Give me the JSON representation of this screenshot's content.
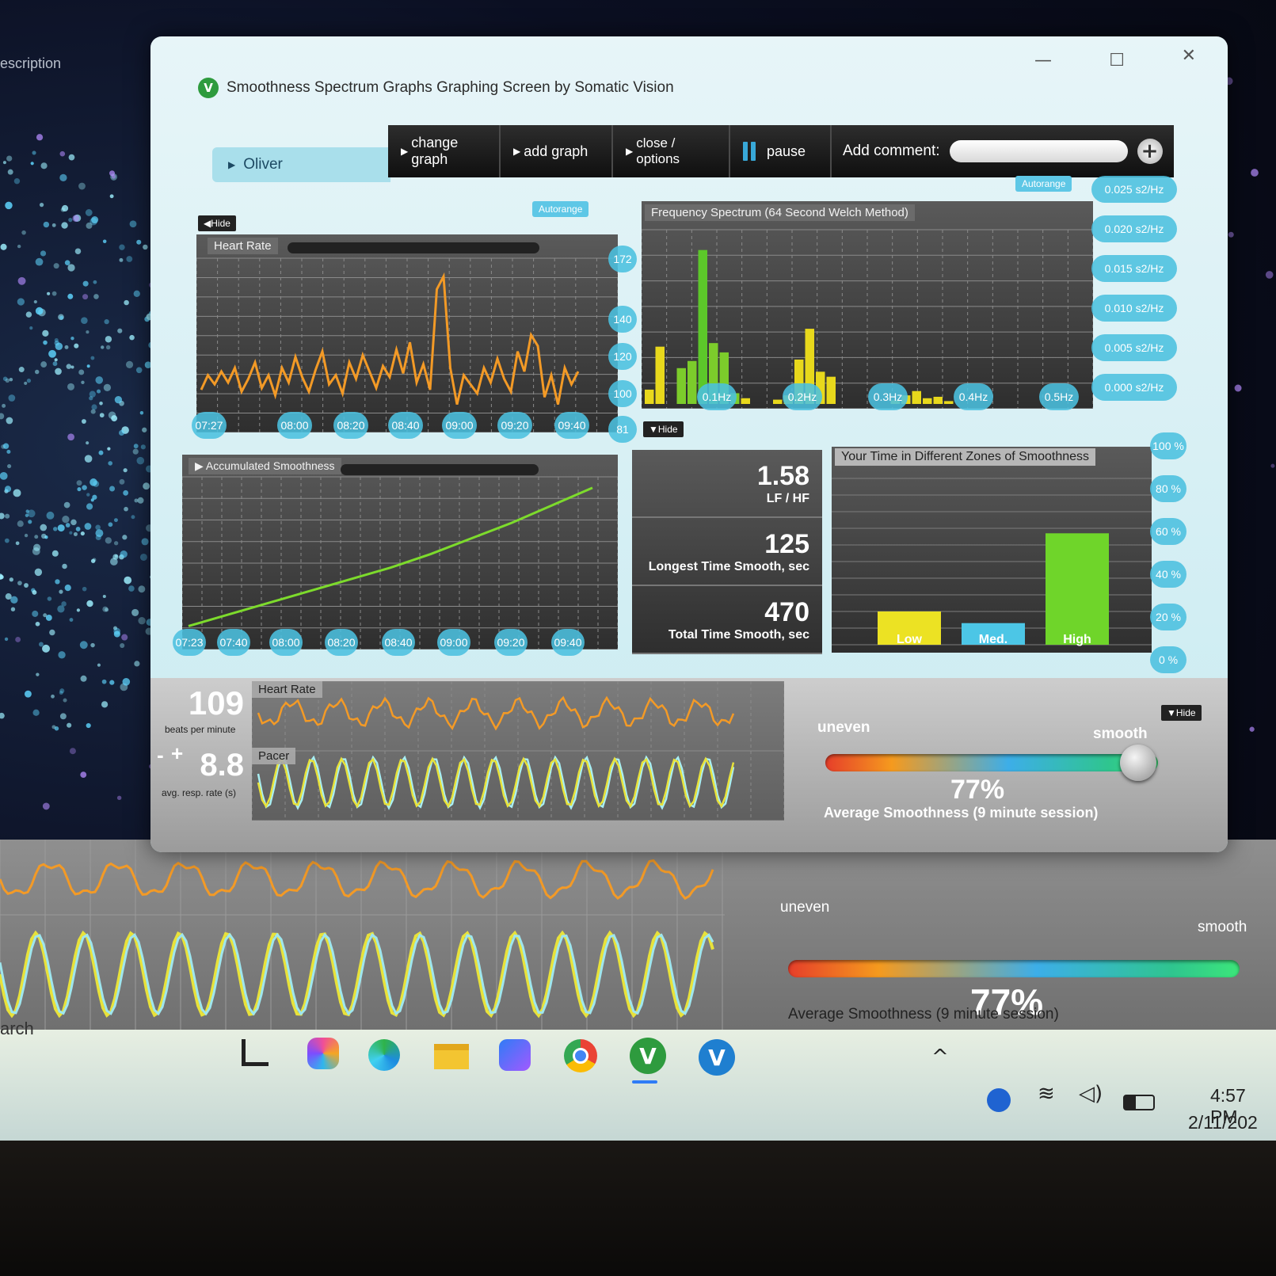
{
  "background": {
    "corner_text": "escription",
    "search_text": "arch"
  },
  "window": {
    "title": "Smoothness Spectrum Graphs Graphing Screen by Somatic Vision",
    "controls": {
      "minimize": "—",
      "maximize": "☐",
      "close": "✕"
    },
    "logo_glyph": "V"
  },
  "user": {
    "name": "Oliver"
  },
  "toolbar": {
    "change_graph": "change graph",
    "add_graph": "add graph",
    "close_options": "close / options",
    "pause": "pause",
    "add_comment_label": "Add comment:",
    "add_comment_value": "",
    "add_comment_plus": "+"
  },
  "heart_rate_panel": {
    "hide_label": "Hide",
    "autorange_label": "Autorange",
    "title": "Heart Rate",
    "y_ticks": [
      "172",
      "140",
      "120",
      "100",
      "81"
    ],
    "x_ticks": [
      "07:27",
      "08:00",
      "08:20",
      "08:40",
      "09:00",
      "09:20",
      "09:40"
    ],
    "series_color": "#f39a26",
    "values": [
      100,
      108,
      103,
      110,
      104,
      112,
      99,
      106,
      115,
      101,
      108,
      97,
      112,
      104,
      118,
      107,
      99,
      111,
      121,
      103,
      108,
      98,
      115,
      106,
      119,
      110,
      101,
      113,
      107,
      122,
      109,
      126,
      104,
      114,
      100,
      155,
      162,
      112,
      92,
      108,
      103,
      98,
      112,
      104,
      117,
      106,
      99,
      121,
      110,
      130,
      124,
      96,
      108,
      92,
      112,
      103,
      110
    ]
  },
  "spectrum_panel": {
    "autorange_label": "Autorange",
    "title": "Frequency Spectrum (64 Second Welch Method)",
    "hide_label": "Hide",
    "y_ticks": [
      "0.025 s2/Hz",
      "0.020 s2/Hz",
      "0.015 s2/Hz",
      "0.010 s2/Hz",
      "0.005 s2/Hz",
      "0.000 s2/Hz"
    ],
    "x_ticks": [
      "0.1Hz",
      "0.2Hz",
      "0.3Hz",
      "0.4Hz",
      "0.5Hz"
    ],
    "colors": {
      "lf": "#e8d81c",
      "vlf_peak": "#5cc72a"
    },
    "bins": [
      0.002,
      0.008,
      0.0,
      0.005,
      0.006,
      0.0215,
      0.0085,
      0.0072,
      0.0015,
      0.0008,
      0.0,
      0.0,
      0.0006,
      0.0012,
      0.0062,
      0.0105,
      0.0045,
      0.0038,
      0.0,
      0.0,
      0.0,
      0.0,
      0.0,
      0.0005,
      0.0012,
      0.0018,
      0.0008,
      0.001,
      0.0004,
      0.0,
      0.0,
      0.0,
      0.0,
      0.0,
      0.0,
      0.0,
      0.0,
      0.0,
      0.0,
      0.0
    ],
    "bin_colors": [
      "#e8d81c",
      "#e8d81c",
      "#e8d81c",
      "#7ccc2b",
      "#7ccc2b",
      "#5cc72a",
      "#7ccc2b",
      "#7ccc2b",
      "#7ccc2b",
      "#e8d81c",
      "#e8d81c",
      "#e8d81c",
      "#e8d81c",
      "#e8d81c",
      "#e8d81c",
      "#e8d81c",
      "#e8d81c",
      "#e8d81c",
      "#e8d81c",
      "#e8d81c",
      "#e8d81c",
      "#e8d81c",
      "#e8d81c",
      "#e8d81c",
      "#e8d81c",
      "#e8d81c",
      "#e8d81c",
      "#e8d81c",
      "#e8d81c",
      "#e8d81c",
      "#e8d81c",
      "#e8d81c",
      "#e8d81c",
      "#e8d81c",
      "#e8d81c",
      "#e8d81c",
      "#e8d81c",
      "#e8d81c",
      "#e8d81c",
      "#e8d81c"
    ]
  },
  "accumulated_panel": {
    "title": "Accumulated Smoothness",
    "x_ticks": [
      "07:23",
      "07:40",
      "08:00",
      "08:20",
      "08:40",
      "09:00",
      "09:20",
      "09:40"
    ],
    "series_color": "#7ddb2c",
    "values": [
      0.12,
      0.18,
      0.24,
      0.3,
      0.36,
      0.42,
      0.49,
      0.57,
      0.65,
      0.74,
      0.83
    ]
  },
  "stats": [
    {
      "value": "1.58",
      "label": "LF / HF"
    },
    {
      "value": "125",
      "label": "Longest Time Smooth, sec"
    },
    {
      "value": "470",
      "label": "Total Time Smooth, sec"
    }
  ],
  "zones_panel": {
    "title": "Your Time in Different Zones of Smoothness",
    "y_ticks": [
      "100 %",
      "80 %",
      "60 %",
      "40 %",
      "20 %",
      "0 %"
    ],
    "chart_data": {
      "type": "bar",
      "title": "Your Time in Different Zones of Smoothness",
      "categories": [
        "Low",
        "Med.",
        "High"
      ],
      "values": [
        20,
        13,
        67
      ],
      "ylim": [
        0,
        100
      ],
      "colors": [
        "#ece223",
        "#4cc6e6",
        "#6fd52a"
      ]
    }
  },
  "live": {
    "heart_rate_value": "109",
    "heart_rate_unit": "beats per minute",
    "heart_rate_label": "Heart Rate",
    "resp_minus": "-",
    "resp_plus": "+",
    "resp_value": "8.8",
    "resp_unit": "avg. resp. rate (s)",
    "pacer_label": "Pacer",
    "hide_label": "Hide"
  },
  "meter": {
    "left_label": "uneven",
    "right_label": "smooth",
    "percent": "77%",
    "caption": "Average Smoothness (9 minute session)",
    "level": 0.94
  },
  "taskbar": {
    "time": "4:57 PM",
    "date": "2/11/202",
    "app_icons": [
      "copilot-icon",
      "edge-icon",
      "file-explorer-icon",
      "bing-icon",
      "chrome-icon",
      "somatic-vision-icon",
      "somatic-vision-2-icon"
    ]
  }
}
